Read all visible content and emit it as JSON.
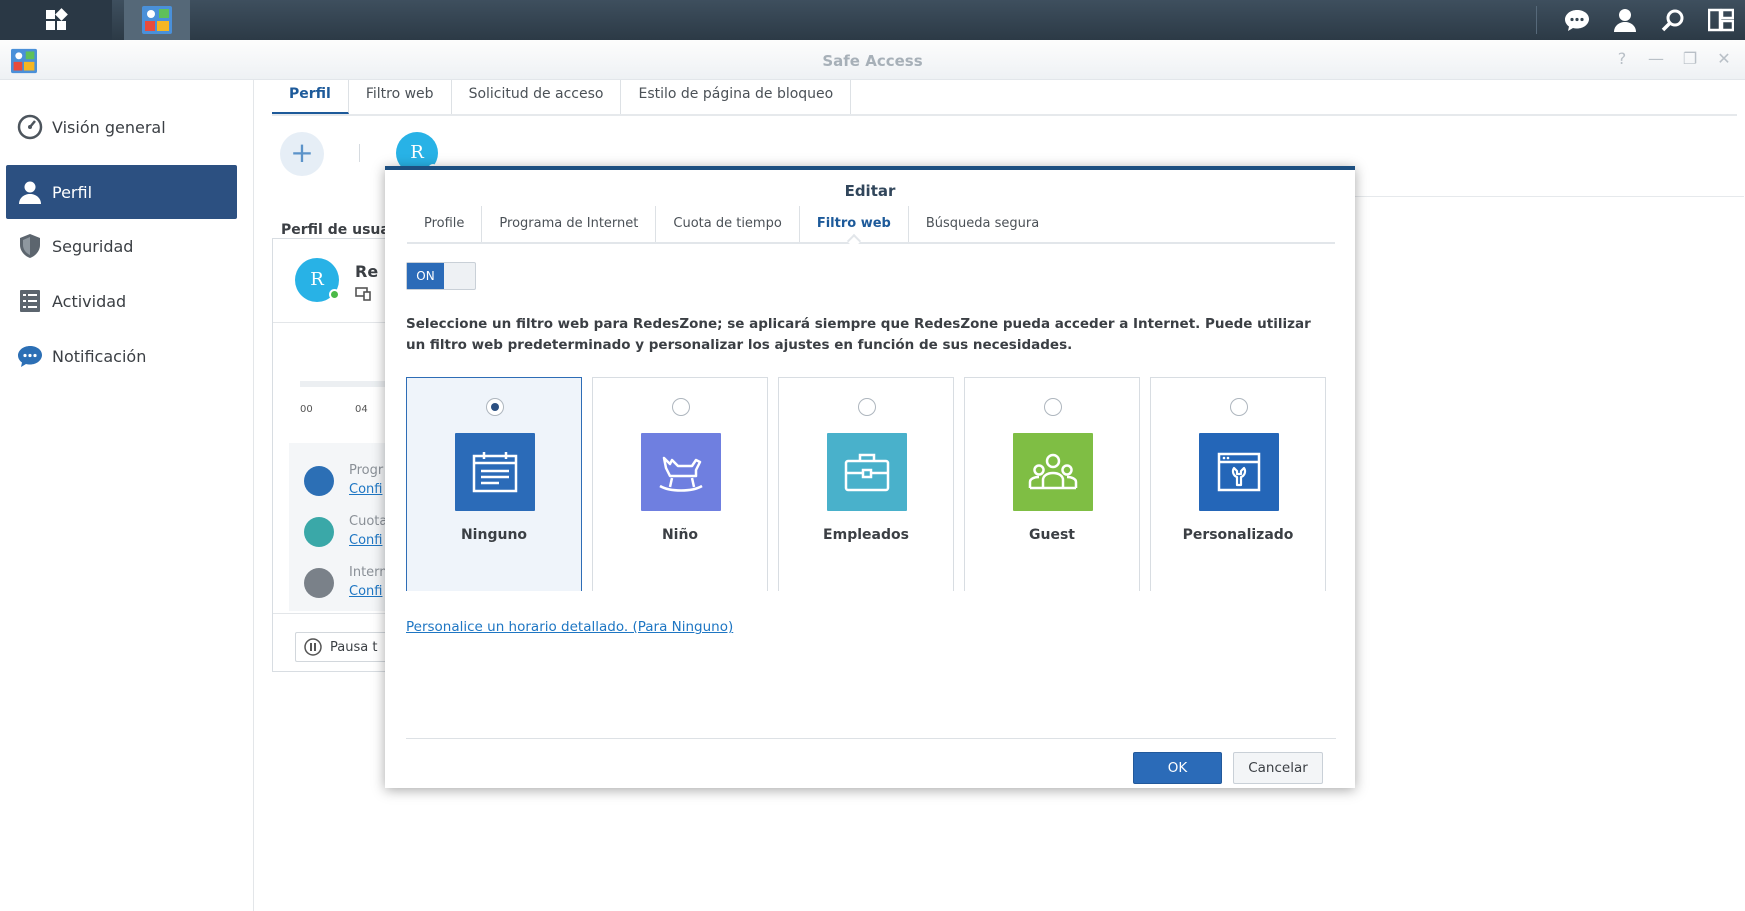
{
  "window": {
    "title": "Safe Access"
  },
  "sidebar": {
    "items": [
      {
        "label": "Visión general",
        "icon": "dashboard-gauge-icon"
      },
      {
        "label": "Perfil",
        "icon": "user-profile-icon",
        "active": true
      },
      {
        "label": "Seguridad",
        "icon": "shield-icon"
      },
      {
        "label": "Actividad",
        "icon": "list-icon"
      },
      {
        "label": "Notificación",
        "icon": "chat-bubble-icon"
      }
    ]
  },
  "main_tabs": [
    "Perfil",
    "Filtro web",
    "Solicitud de acceso",
    "Estilo de página de bloqueo"
  ],
  "profile": {
    "avatar_letter": "R"
  },
  "background": {
    "section_label": "Perfil de usuar",
    "avatar_letter": "R",
    "name": "Re",
    "ticks": [
      "00",
      "04"
    ],
    "rows": [
      {
        "title": "Progr",
        "link": "Confi"
      },
      {
        "title": "Cuota",
        "link": "Confi"
      },
      {
        "title": "Intern",
        "link": "Confi"
      }
    ],
    "pause_label": "Pausa t"
  },
  "dialog": {
    "title": "Editar",
    "tabs": [
      "Profile",
      "Programa de Internet",
      "Cuota de tiempo",
      "Filtro web",
      "Búsqueda segura"
    ],
    "active_tab": "Filtro web",
    "toggle_label": "ON",
    "description": "Seleccione un filtro web para RedesZone; se aplicará siempre que RedesZone pueda acceder a Internet. Puede utilizar un filtro web predeterminado y personalizar los ajustes en función de sus necesidades.",
    "filters": [
      {
        "label": "Ninguno",
        "color": "#2b6bb8",
        "icon": "calendar-list-icon",
        "selected": true
      },
      {
        "label": "Niño",
        "color": "#6f7fe0",
        "icon": "rocking-horse-icon",
        "selected": false
      },
      {
        "label": "Empleados",
        "color": "#49b1cb",
        "icon": "briefcase-icon",
        "selected": false
      },
      {
        "label": "Guest",
        "color": "#7fbe44",
        "icon": "group-people-icon",
        "selected": false
      },
      {
        "label": "Personalizado",
        "color": "#2466b8",
        "icon": "browser-wrench-icon",
        "selected": false
      }
    ],
    "schedule_link": "Personalice un horario detallado. (Para Ninguno)",
    "ok_label": "OK",
    "cancel_label": "Cancelar"
  }
}
